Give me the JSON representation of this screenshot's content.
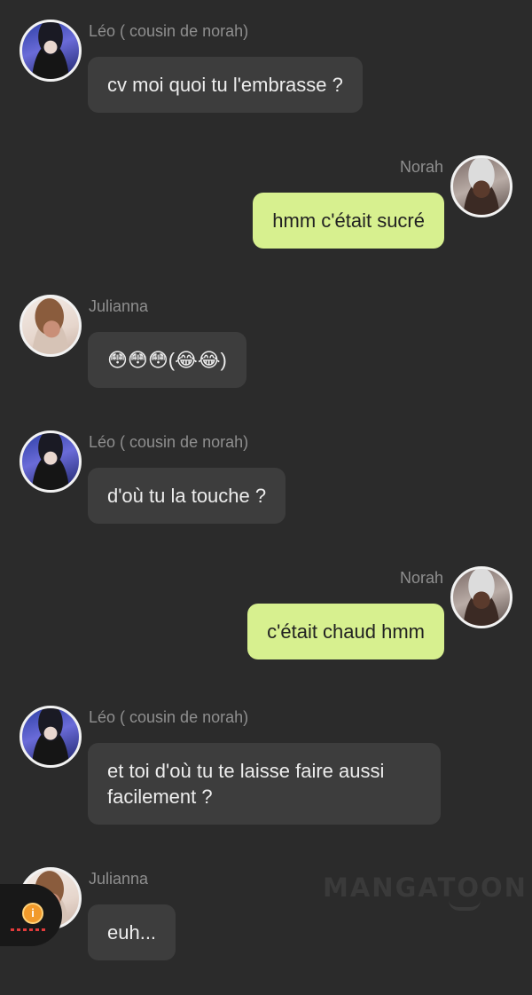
{
  "messages": [
    {
      "sender": "Léo ( cousin de norah)",
      "side": "left",
      "avatar": "avatar-leo",
      "text": "cv moi quoi tu l'embrasse ?"
    },
    {
      "sender": "Norah",
      "side": "right",
      "avatar": "avatar-norah",
      "text": "hmm c'était sucré"
    },
    {
      "sender": "Julianna",
      "side": "left",
      "avatar": "avatar-julianna",
      "text": "😳😳😳(😂😂)"
    },
    {
      "sender": "Léo ( cousin de norah)",
      "side": "left",
      "avatar": "avatar-leo",
      "text": "d'où tu la touche ?"
    },
    {
      "sender": "Norah",
      "side": "right",
      "avatar": "avatar-norah",
      "text": "c'était chaud hmm"
    },
    {
      "sender": "Léo ( cousin de norah)",
      "side": "left",
      "avatar": "avatar-leo",
      "text": "et toi d'où tu te laisse faire aussi\nfacilement ?"
    },
    {
      "sender": "Julianna",
      "side": "left",
      "avatar": "avatar-julianna",
      "text": "euh..."
    }
  ],
  "watermark": "MANGATOON",
  "widget": {
    "icon": "info-icon",
    "glyph": "i"
  },
  "colors": {
    "background": "#2b2b2b",
    "bubble_left": "#3d3d3d",
    "bubble_right": "#d7f08f",
    "name_text": "#8f8f8f"
  }
}
